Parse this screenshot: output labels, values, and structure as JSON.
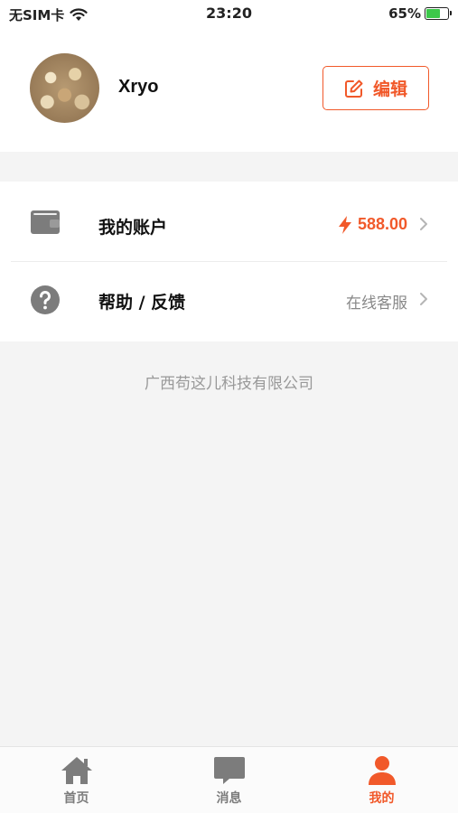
{
  "status_bar": {
    "carrier": "无SIM卡",
    "time": "23:20",
    "battery_percent": "65%",
    "battery_level": 0.65
  },
  "profile": {
    "username": "Xryo",
    "edit_label": "编辑"
  },
  "menu": {
    "items": [
      {
        "label": "我的账户",
        "value": "588.00",
        "icon": "wallet-icon"
      },
      {
        "label": "帮助 / 反馈",
        "value": "在线客服",
        "icon": "help-circle-icon"
      }
    ]
  },
  "footer": {
    "company": "广西苟这儿科技有限公司"
  },
  "tabbar": {
    "tabs": [
      {
        "label": "首页",
        "icon": "home-icon"
      },
      {
        "label": "消息",
        "icon": "message-icon"
      },
      {
        "label": "我的",
        "icon": "person-icon"
      }
    ],
    "active": "我的"
  },
  "colors": {
    "accent": "#f1592a",
    "icon_gray": "#7c7c7c",
    "background": "#f4f4f4"
  }
}
